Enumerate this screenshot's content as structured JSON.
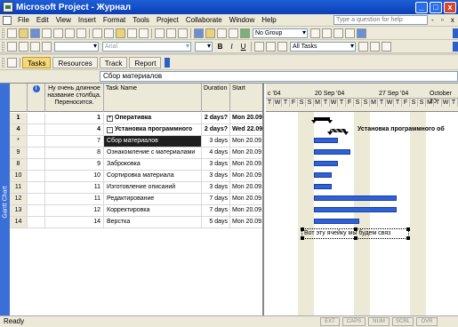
{
  "window": {
    "title": "Microsoft Project - Журнал",
    "min": "_",
    "max": "□",
    "close": "x"
  },
  "menu": {
    "items": [
      "File",
      "Edit",
      "View",
      "Insert",
      "Format",
      "Tools",
      "Project",
      "Collaborate",
      "Window",
      "Help"
    ],
    "help_placeholder": "Type a question for help"
  },
  "toolbar": {
    "group_combo": "No Group",
    "font_combo": "Arial",
    "filter_combo": "All Tasks"
  },
  "guide": {
    "tasks": "Tasks",
    "resources": "Resources",
    "track": "Track",
    "report": "Report"
  },
  "entry_bar": {
    "value": "Сбор материалов"
  },
  "view_bar": {
    "label": "Gantt Chart"
  },
  "grid": {
    "headers": {
      "id": "",
      "indicator": "i",
      "custom": "Ну очень длинное название столбца. Переносится.",
      "name": "Task Name",
      "duration": "Duration",
      "start": "Start"
    },
    "rows": [
      {
        "id": "1",
        "col": "1",
        "name": "Оперативка",
        "dur": "2 days?",
        "start": "Mon 20.09.",
        "bold": true,
        "toggle": "+"
      },
      {
        "id": "4",
        "col": "4",
        "name": "Установка программного",
        "dur": "2 days?",
        "start": "Wed 22.09.",
        "bold": true,
        "toggle": "-"
      },
      {
        "id": "*",
        "col": "7",
        "name": "Сбор материалов",
        "dur": "3 days",
        "start": "Mon 20.09.",
        "selected": true
      },
      {
        "id": "9",
        "col": "8",
        "name": "Ознакомление с материалами",
        "dur": "4 days",
        "start": "Mon 20.09."
      },
      {
        "id": "8",
        "col": "9",
        "name": "Заброковка",
        "dur": "3 days",
        "start": "Mon 20.09."
      },
      {
        "id": "10",
        "col": "10",
        "name": "Сортировка материала",
        "dur": "3 days",
        "start": "Mon 20.09."
      },
      {
        "id": "11",
        "col": "11",
        "name": "Изготовление описаний",
        "dur": "3 days",
        "start": "Mon 20.09."
      },
      {
        "id": "12",
        "col": "11",
        "name": "Редактирование",
        "dur": "7 days",
        "start": "Mon 20.09."
      },
      {
        "id": "13",
        "col": "12",
        "name": "Корректировка",
        "dur": "7 days",
        "start": "Mon 20.09."
      },
      {
        "id": "14",
        "col": "14",
        "name": "Верстка",
        "dur": "5 days",
        "start": "Mon 20.09."
      }
    ]
  },
  "timescale": {
    "weeks": [
      "c '04",
      "20 Sep '04",
      "27 Sep '04",
      "October 20"
    ],
    "days": [
      "T",
      "W",
      "T",
      "F",
      "S",
      "S",
      "M",
      "T",
      "W",
      "T",
      "F",
      "S",
      "S",
      "M",
      "T",
      "W",
      "T",
      "F",
      "S",
      "S",
      "M",
      "T",
      "W",
      "T"
    ]
  },
  "chart_labels": {
    "summary_label": "Установка программного об"
  },
  "note_text": "Вот эту ячейку мы будем связ",
  "status": {
    "ready": "Ready",
    "indicators": [
      "EXT",
      "CAPS",
      "NUM",
      "SCRL",
      "OVR"
    ]
  }
}
